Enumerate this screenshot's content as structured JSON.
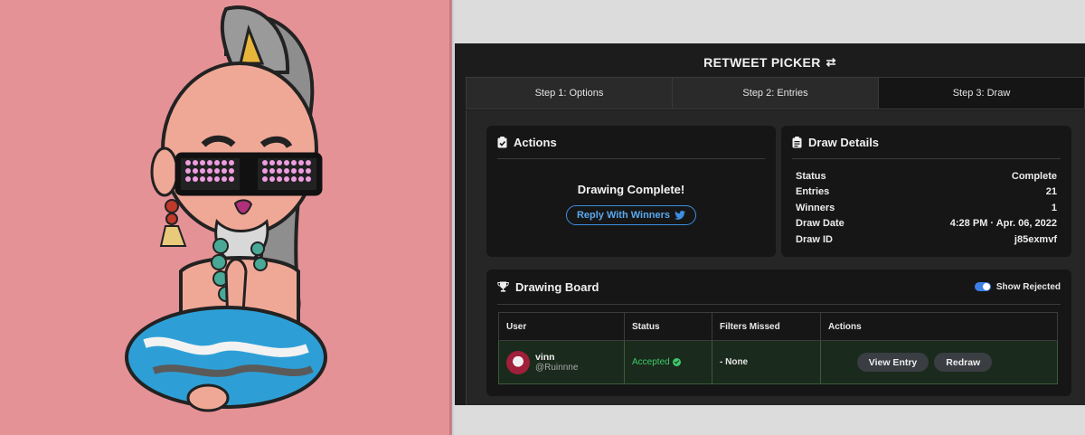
{
  "app": {
    "title": "RETWEET PICKER",
    "title_icon": "retweet-icon"
  },
  "tabs": [
    {
      "label": "Step 1: Options"
    },
    {
      "label": "Step 2: Entries"
    },
    {
      "label": "Step 3: Draw",
      "active": true
    }
  ],
  "actions": {
    "heading": "Actions",
    "heading_icon": "clipboard-check-icon",
    "status_text": "Drawing Complete!",
    "reply_label": "Reply With Winners",
    "reply_icon": "twitter-bird-icon"
  },
  "details": {
    "heading": "Draw Details",
    "heading_icon": "clipboard-list-icon",
    "rows": [
      {
        "label": "Status",
        "value": "Complete"
      },
      {
        "label": "Entries",
        "value": "21"
      },
      {
        "label": "Winners",
        "value": "1"
      },
      {
        "label": "Draw Date",
        "value": "4:28 PM · Apr. 06, 2022"
      },
      {
        "label": "Draw ID",
        "value": "j85exmvf"
      }
    ]
  },
  "board": {
    "heading": "Drawing Board",
    "heading_icon": "trophy-icon",
    "toggle_label": "Show Rejected",
    "toggle_on": true,
    "columns": [
      "User",
      "Status",
      "Filters Missed",
      "Actions"
    ],
    "rows": [
      {
        "name": "vinn",
        "handle": "@Ruinnne",
        "status": "Accepted",
        "filters_missed": "- None",
        "view_label": "View Entry",
        "redraw_label": "Redraw"
      }
    ]
  },
  "colors": {
    "art_background": "#e59297",
    "app_background": "#1c1c1c",
    "accent_blue": "#3d8ee0",
    "accepted_green": "#3fc86a"
  }
}
